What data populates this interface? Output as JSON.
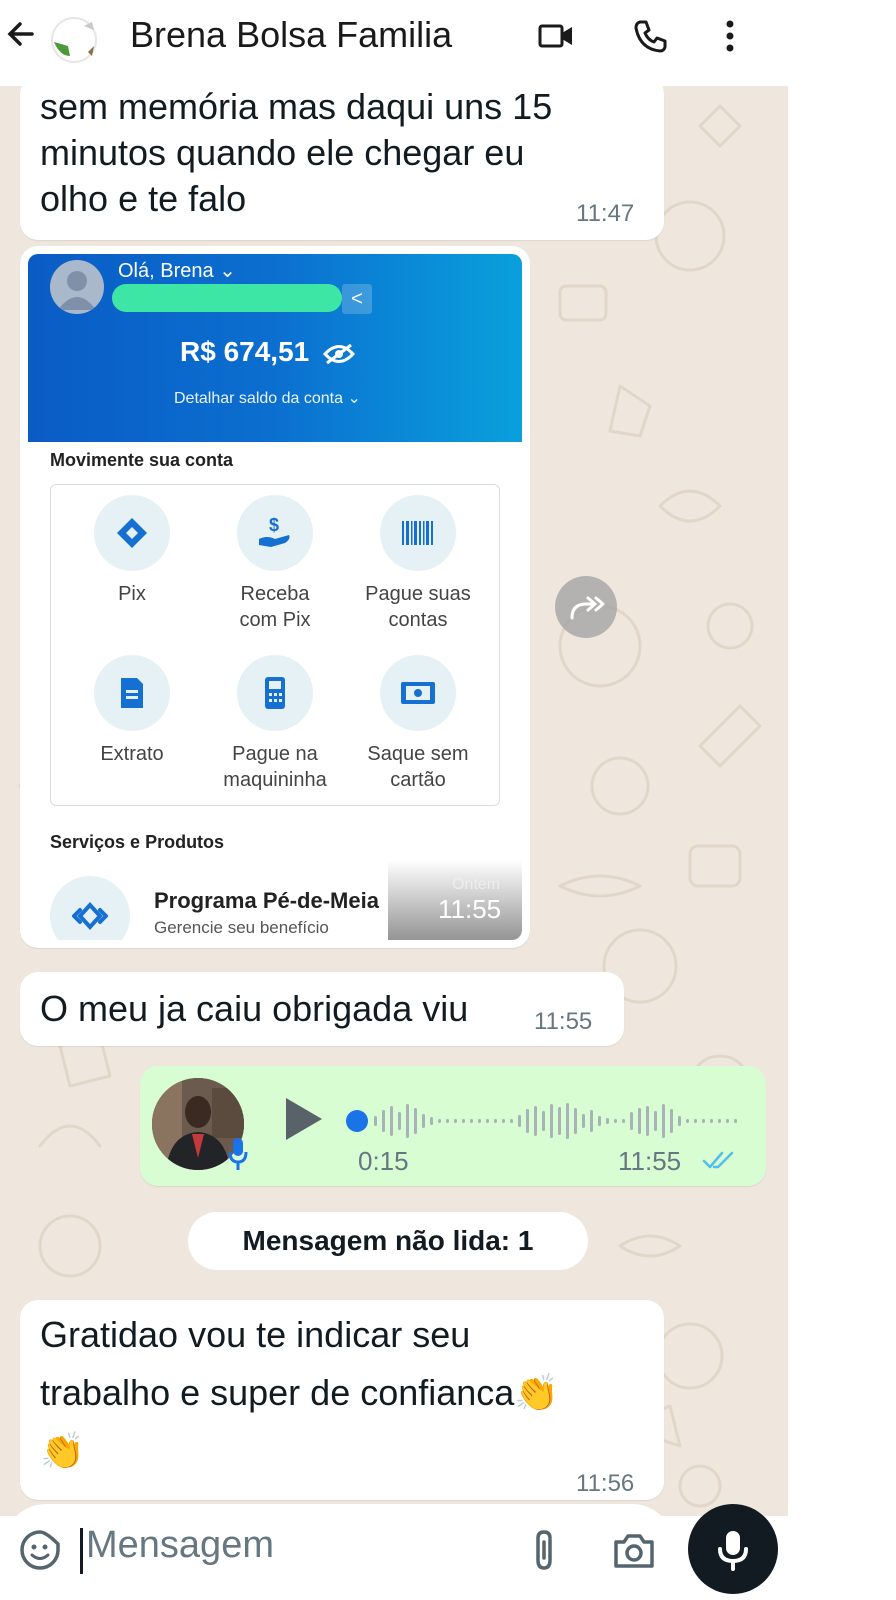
{
  "header": {
    "contact_name": "Brena Bolsa Familia",
    "icons": [
      "back-arrow-icon",
      "video-call-icon",
      "voice-call-icon",
      "more-options-icon"
    ]
  },
  "messages": [
    {
      "type": "text",
      "direction": "incoming",
      "lines": [
        "sem memória mas daqui uns 15",
        "minutos quando ele chegar eu",
        "olho e te falo"
      ],
      "time": "11:47"
    },
    {
      "type": "image",
      "direction": "incoming",
      "card": {
        "greeting": "Olá, Brena",
        "balance": "R$ 674,51",
        "detail_link": "Detalhar saldo da conta",
        "section_move": "Movimente sua conta",
        "actions": [
          {
            "label_lines": [
              "Pix"
            ],
            "icon": "pix-icon"
          },
          {
            "label_lines": [
              "Receba",
              "com Pix"
            ],
            "icon": "receive-money-icon"
          },
          {
            "label_lines": [
              "Pague suas",
              "contas"
            ],
            "icon": "barcode-icon"
          },
          {
            "label_lines": [
              "Extrato"
            ],
            "icon": "statement-icon"
          },
          {
            "label_lines": [
              "Pague na",
              "maquininha"
            ],
            "icon": "card-machine-icon"
          },
          {
            "label_lines": [
              "Saque sem",
              "cartão"
            ],
            "icon": "cash-withdraw-icon"
          }
        ],
        "section_services": "Serviços e Produtos",
        "program_title": "Programa Pé-de-Meia",
        "program_subtitle": "Gerencie seu benefício",
        "overlay_label": "Ontem"
      },
      "time": "11:55"
    },
    {
      "type": "text",
      "direction": "incoming",
      "lines": [
        "O meu ja caiu obrigada viu"
      ],
      "time": "11:55"
    },
    {
      "type": "voice",
      "direction": "outgoing",
      "duration": "0:15",
      "time": "11:55",
      "status": "read"
    },
    {
      "type": "text",
      "direction": "incoming",
      "lines": [
        "Gratidao vou te indicar seu",
        "trabalho e super de confianca👏",
        "👏"
      ],
      "time": "11:56"
    }
  ],
  "unread_banner": "Mensagem não lida: 1",
  "composer": {
    "placeholder": "Mensagem",
    "icons": [
      "emoji-icon",
      "attach-icon",
      "camera-icon",
      "microphone-icon"
    ]
  },
  "colors": {
    "chat_background": "#efe7dd",
    "outgoing_bubble": "#d9fdd3",
    "incoming_bubble": "#ffffff",
    "read_tick": "#53bdeb",
    "bank_blue": "#0b6fd0"
  }
}
